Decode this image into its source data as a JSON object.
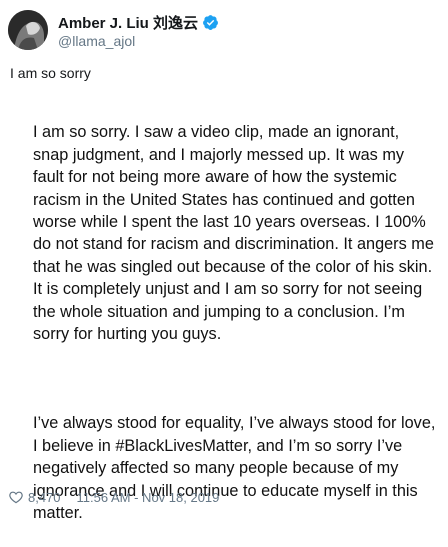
{
  "author": {
    "display_name": "Amber J. Liu 刘逸云",
    "handle": "@llama_ajol",
    "avatar_icon": "profile-photo",
    "verified_icon": "verified-badge-icon",
    "verified_color": "#1da1f2"
  },
  "tweet": {
    "text": "I am so sorry",
    "statement_paragraph_1": "I am so sorry. I saw a video clip, made an ignorant, snap judgment, and I majorly messed up. It was my fault for not being more aware of how the systemic racism in the United States has continued and gotten worse while I spent the last 10 years overseas. I 100% do not stand for racism and discrimination. It angers me that he was singled out because of the color of his skin. It is completely unjust and I am so sorry for not seeing the whole situation and jumping to a conclusion. I’m sorry for hurting you guys.",
    "statement_paragraph_2": "I’ve always stood for equality, I’ve always stood for love, I believe in #BlackLivesMatter, and I’m so sorry I’ve negatively affected so many people because of my ignorance and I will continue to educate myself in this matter."
  },
  "footer": {
    "like_icon": "heart-icon",
    "like_count": "8,470",
    "timestamp": "11:56 AM - Nov 18, 2019"
  }
}
